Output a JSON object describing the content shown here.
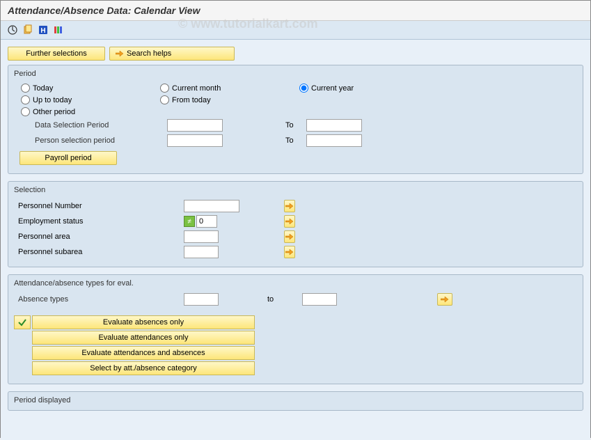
{
  "title": "Attendance/Absence Data: Calendar View",
  "watermark": "© www.tutorialkart.com",
  "topbuttons": {
    "further_selections": "Further selections",
    "search_helps": "Search helps"
  },
  "period": {
    "title": "Period",
    "today": "Today",
    "current_month": "Current month",
    "current_year": "Current year",
    "up_to_today": "Up to today",
    "from_today": "From today",
    "other_period": "Other period",
    "data_selection_period": "Data Selection Period",
    "person_selection_period": "Person selection period",
    "to": "To",
    "payroll_period": "Payroll period",
    "data_sel_from": "",
    "data_sel_to": "",
    "person_sel_from": "",
    "person_sel_to": ""
  },
  "selection": {
    "title": "Selection",
    "personnel_number": "Personnel Number",
    "employment_status": "Employment status",
    "personnel_area": "Personnel area",
    "personnel_subarea": "Personnel subarea",
    "personnel_number_val": "",
    "employment_status_val": "0",
    "personnel_area_val": "",
    "personnel_subarea_val": ""
  },
  "eval": {
    "title": "Attendance/absence types for eval.",
    "absence_types": "Absence types",
    "to": "to",
    "absence_from": "",
    "absence_to": "",
    "b1": "Evaluate absences only",
    "b2": "Evaluate attendances only",
    "b3": "Evaluate attendances and absences",
    "b4": "Select by att./absence category"
  },
  "period_displayed": {
    "title": "Period displayed"
  }
}
